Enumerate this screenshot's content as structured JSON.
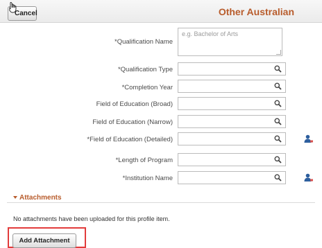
{
  "header": {
    "cancel_label": "Cancel",
    "title": "Other Australian"
  },
  "form": {
    "qualification_name": {
      "label": "*Qualification Name",
      "placeholder": "e.g. Bachelor of Arts",
      "value": ""
    },
    "qualification_type": {
      "label": "*Qualification Type",
      "value": ""
    },
    "completion_year": {
      "label": "*Completion Year",
      "value": ""
    },
    "field_broad": {
      "label": "Field of Education (Broad)",
      "value": ""
    },
    "field_narrow": {
      "label": "Field of Education (Narrow)",
      "value": ""
    },
    "field_detailed": {
      "label": "*Field of Education (Detailed)",
      "value": ""
    },
    "length_of_program": {
      "label": "*Length of Program",
      "value": ""
    },
    "institution_name": {
      "label": "*Institution Name",
      "value": ""
    }
  },
  "icons": {
    "lookup": "magnifier-icon",
    "related_info": "person-icon",
    "cursor": "hand-cursor-icon"
  },
  "attachments": {
    "section_label": "Attachments",
    "empty_text": "No attachments have been uploaded for this profile item.",
    "add_label": "Add Attachment"
  },
  "colors": {
    "accent": "#b85c2c",
    "highlight": "#e23b3b",
    "person_icon": "#2e5f9e"
  }
}
